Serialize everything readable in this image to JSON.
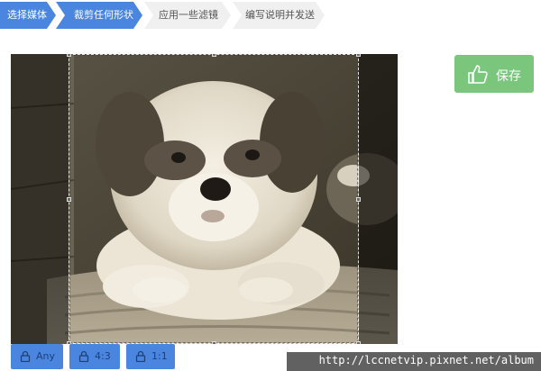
{
  "steps": [
    {
      "label": "选择媒体",
      "active": true
    },
    {
      "label": "裁剪任何形状",
      "active": true
    },
    {
      "label": "应用一些滤镜",
      "active": false
    },
    {
      "label": "编写说明并发送",
      "active": false
    }
  ],
  "toolbar": {
    "save_label": "保存",
    "save_icon": "thumbs-up-icon"
  },
  "aspect_ratios": [
    {
      "label": "Any",
      "icon": "lock-icon"
    },
    {
      "label": "4:3",
      "icon": "lock-icon"
    },
    {
      "label": "1:1",
      "icon": "lock-icon"
    }
  ],
  "watermark": "http://lccnetvip.pixnet.net/album",
  "colors": {
    "step_active": "#4a86e0",
    "step_inactive": "#f0f0f0",
    "save_button": "#7bc67d",
    "ratio_button": "#4a86e0"
  }
}
